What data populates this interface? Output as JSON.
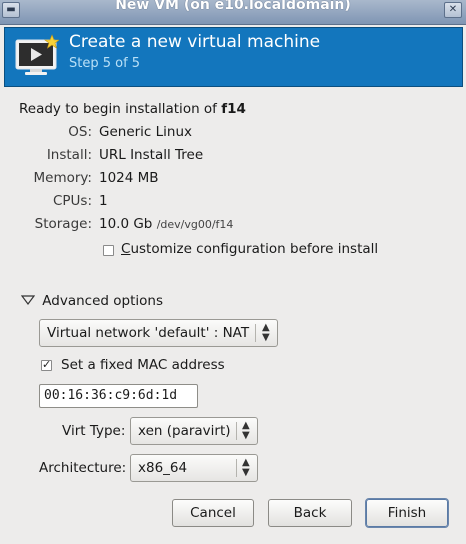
{
  "window": {
    "title": "New VM (on e10.localdomain)"
  },
  "header": {
    "title": "Create a new virtual machine",
    "step": "Step 5 of 5"
  },
  "summary": {
    "ready_prefix": "Ready to begin installation of",
    "vm_name": "f14",
    "rows": [
      {
        "label": "OS:",
        "value": "Generic Linux"
      },
      {
        "label": "Install:",
        "value": "URL Install Tree"
      },
      {
        "label": "Memory:",
        "value": "1024 MB"
      },
      {
        "label": "CPUs:",
        "value": "1"
      },
      {
        "label": "Storage:",
        "value": "10.0 Gb",
        "extra": "/dev/vg00/f14"
      }
    ],
    "customize": {
      "label": "Customize configuration before install",
      "checked": false
    }
  },
  "advanced": {
    "label": "Advanced options",
    "network": {
      "selected": "Virtual network 'default' : NAT"
    },
    "fixed_mac": {
      "label": "Set a fixed MAC address",
      "checked": true
    },
    "mac_address": "00:16:36:c9:6d:1d",
    "virt_type": {
      "label": "Virt Type:",
      "selected": "xen (paravirt)"
    },
    "architecture": {
      "label": "Architecture:",
      "selected": "x86_64"
    }
  },
  "buttons": {
    "cancel": "Cancel",
    "back": "Back",
    "finish": "Finish"
  },
  "colors": {
    "banner": "#1376bd",
    "banner_subtitle": "#b9e0f7",
    "window_bg": "#edeceb"
  }
}
